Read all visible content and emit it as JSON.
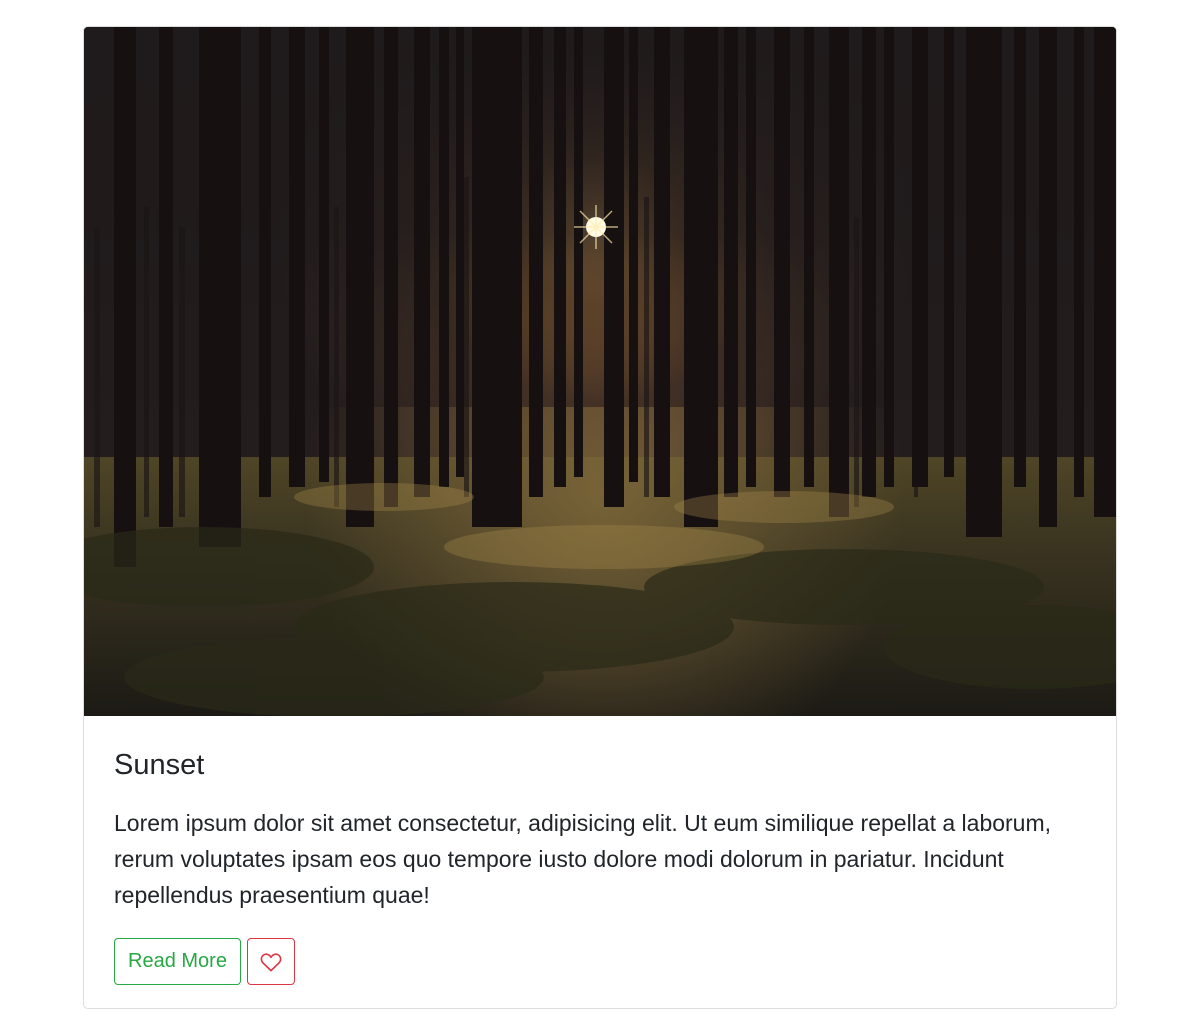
{
  "card": {
    "image_alt": "Sun shining through tall pine trees in a dark forest",
    "title": "Sunset",
    "text": "Lorem ipsum dolor sit amet consectetur, adipisicing elit. Ut eum similique repellat a laborum, rerum voluptates ipsam eos quo tempore iusto dolore modi dolorum in pariatur. Incidunt repellendus praesentium quae!",
    "read_more_label": "Read More",
    "favorite_icon": "heart-icon"
  },
  "colors": {
    "read_more": "#28a745",
    "favorite": "#dc3545",
    "text": "#212529",
    "border": "#dcdcdc"
  }
}
